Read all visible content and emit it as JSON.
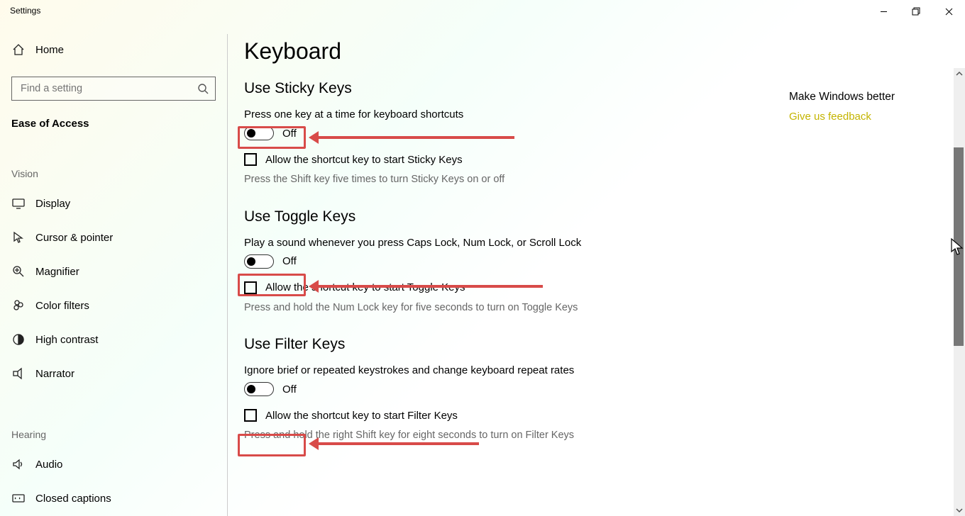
{
  "window": {
    "title": "Settings"
  },
  "sidebar": {
    "home": "Home",
    "search_placeholder": "Find a setting",
    "category": "Ease of Access",
    "group1_title": "Vision",
    "items1": [
      {
        "label": "Display",
        "icon": "display-icon"
      },
      {
        "label": "Cursor & pointer",
        "icon": "pointer-icon"
      },
      {
        "label": "Magnifier",
        "icon": "magnifier-icon"
      },
      {
        "label": "Color filters",
        "icon": "color-filters-icon"
      },
      {
        "label": "High contrast",
        "icon": "high-contrast-icon"
      },
      {
        "label": "Narrator",
        "icon": "narrator-icon"
      }
    ],
    "group2_title": "Hearing",
    "items2": [
      {
        "label": "Audio",
        "icon": "audio-icon"
      },
      {
        "label": "Closed captions",
        "icon": "captions-icon"
      }
    ]
  },
  "page": {
    "title": "Keyboard"
  },
  "sections": {
    "sticky": {
      "heading": "Use Sticky Keys",
      "desc": "Press one key at a time for keyboard shortcuts",
      "toggle_state": "Off",
      "checkbox_label": "Allow the shortcut key to start Sticky Keys",
      "hint": "Press the Shift key five times to turn Sticky Keys on or off"
    },
    "toggle": {
      "heading": "Use Toggle Keys",
      "desc": "Play a sound whenever you press Caps Lock, Num Lock, or Scroll Lock",
      "toggle_state": "Off",
      "checkbox_label": "Allow the shortcut key to start Toggle Keys",
      "hint": "Press and hold the Num Lock key for five seconds to turn on Toggle Keys"
    },
    "filter": {
      "heading": "Use Filter Keys",
      "desc": "Ignore brief or repeated keystrokes and change keyboard repeat rates",
      "toggle_state": "Off",
      "checkbox_label": "Allow the shortcut key to start Filter Keys",
      "hint": "Press and hold the right Shift key for eight seconds to turn on Filter Keys"
    }
  },
  "rail": {
    "title": "Make Windows better",
    "link": "Give us feedback"
  },
  "annot_color": "#D84B49"
}
